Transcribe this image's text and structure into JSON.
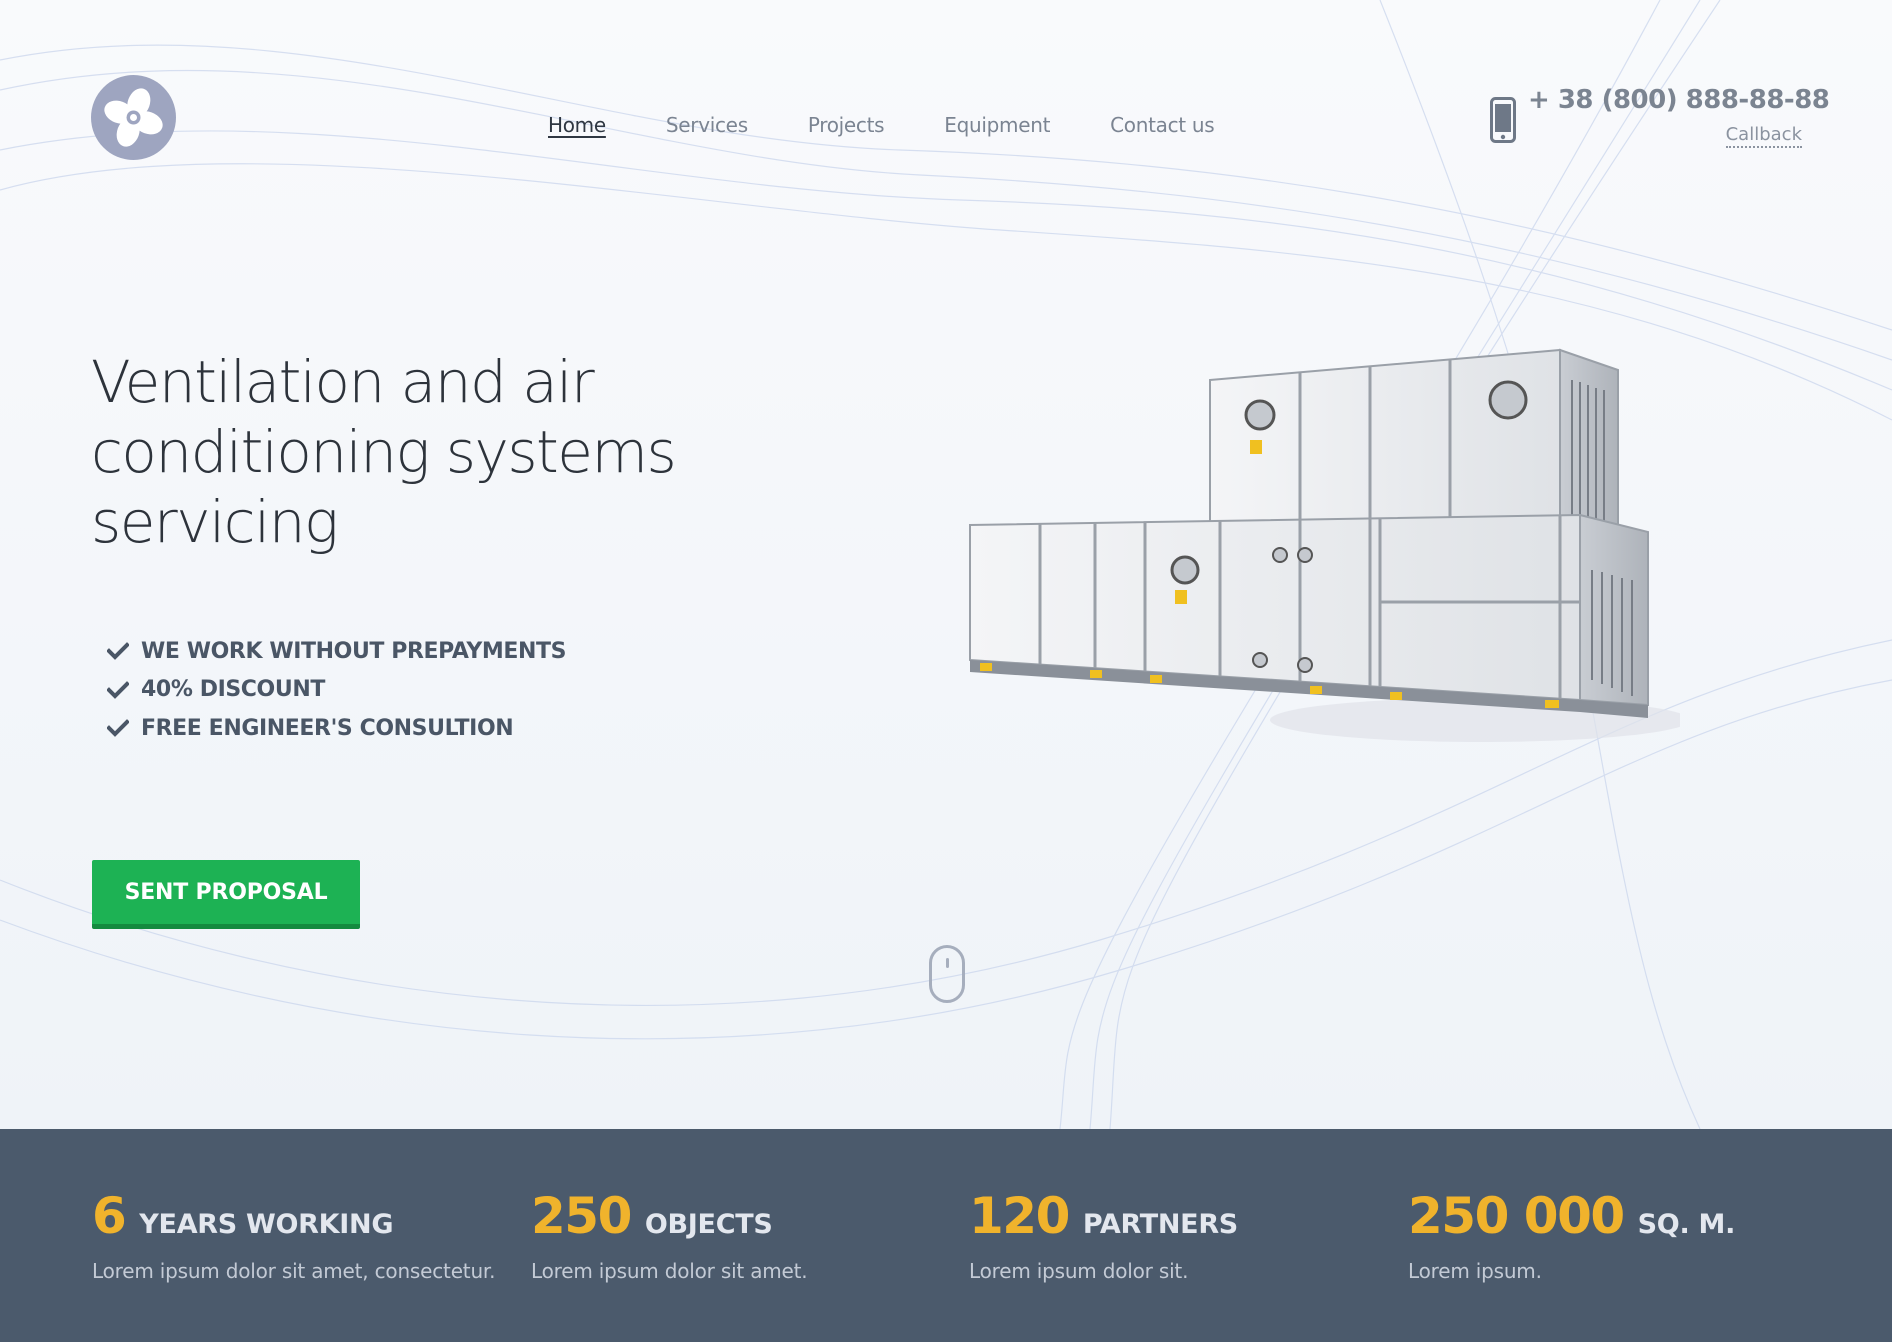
{
  "header": {
    "logo_icon": "fan-icon",
    "nav": [
      {
        "label": "Home",
        "active": true
      },
      {
        "label": "Services",
        "active": false
      },
      {
        "label": "Projects",
        "active": false
      },
      {
        "label": "Equipment",
        "active": false
      },
      {
        "label": "Contact us",
        "active": false
      }
    ],
    "phone": {
      "icon": "mobile-phone-icon",
      "number": "+ 38 (800) 888-88-88",
      "callback_label": "Callback"
    }
  },
  "hero": {
    "headline": "Ventilation and air conditioning systems servicing",
    "benefits": [
      "WE WORK WITHOUT PREPAYMENTS",
      "40% DISCOUNT",
      "FREE ENGINEER'S CONSULTION"
    ],
    "benefit_icon": "check-icon",
    "cta_label": "SENT PROPOSAL",
    "scroll_icon": "mouse-scroll-icon",
    "image": "air-handling-unit-image"
  },
  "stats": [
    {
      "number": "6",
      "label": "YEARS WORKING",
      "text": "Lorem ipsum dolor sit amet, consectetur."
    },
    {
      "number": "250",
      "label": "OBJECTS",
      "text": "Lorem ipsum dolor sit amet."
    },
    {
      "number": "120",
      "label": "PARTNERS",
      "text": "Lorem ipsum dolor sit."
    },
    {
      "number": "250 000",
      "label": "SQ. M.",
      "text": "Lorem ipsum."
    }
  ],
  "colors": {
    "accent_green": "#1db254",
    "stat_number_yellow": "#f0b32c",
    "stats_background": "#4b5a6c",
    "headline_text": "#2d333b"
  }
}
